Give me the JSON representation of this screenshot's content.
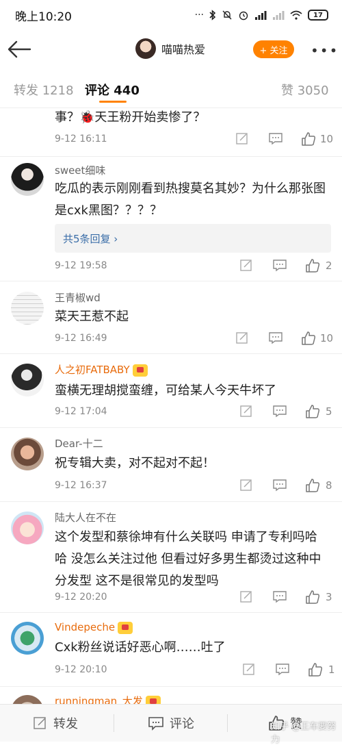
{
  "status": {
    "time": "晚上10:20",
    "dots": "···",
    "battery": "17"
  },
  "nav": {
    "user_name": "喵喵热爱",
    "follow_label": "+ 关注",
    "more_label": "•••"
  },
  "tabs": {
    "repost": "转发 1218",
    "comment": "评论 440",
    "like": "赞 3050"
  },
  "comments": [
    {
      "author": "",
      "text": "事？🐞天王粉开始卖惨了？",
      "date": "9-12 16:11",
      "likes": "10"
    },
    {
      "author": "sweet细味",
      "text": "吃瓜的表示刚刚看到热搜莫名其妙？为什么那张图是cxk黑图？？？？",
      "replies": "共5条回复 ›",
      "date": "9-12 19:58",
      "likes": "2"
    },
    {
      "author": "王青椒wd",
      "text": "菜天王惹不起",
      "date": "9-12 16:49",
      "likes": "10"
    },
    {
      "author": "人之初FATBABY",
      "text": "蛮横无理胡搅蛮缠，可给某人今天牛坏了",
      "date": "9-12 17:04",
      "likes": "5"
    },
    {
      "author": "Dear-十二",
      "text": "祝专辑大卖，对不起对不起！",
      "date": "9-12 16:37",
      "likes": "8"
    },
    {
      "author": "陆大人在不在",
      "text": "这个发型和蔡徐坤有什么关联吗 申请了专利吗哈哈 没怎么关注过他 但看过好多男生都烫过这种中分发型 这不是很常见的发型吗",
      "date": "9-12 20:20",
      "likes": "3"
    },
    {
      "author": "Vindepeche",
      "text": "Cxk粉丝说话好恶心啊……吐了",
      "date": "9-12 20:10",
      "likes": "1"
    },
    {
      "author": "runningman_大发"
    }
  ],
  "bottom": {
    "repost": "转发",
    "comment": "评论",
    "like": "赞",
    "watermark": "知乎 @王车要努力"
  },
  "colors": {
    "accent": "#ff8200",
    "vip_name": "#e86b0c",
    "link": "#3b6ea8"
  }
}
